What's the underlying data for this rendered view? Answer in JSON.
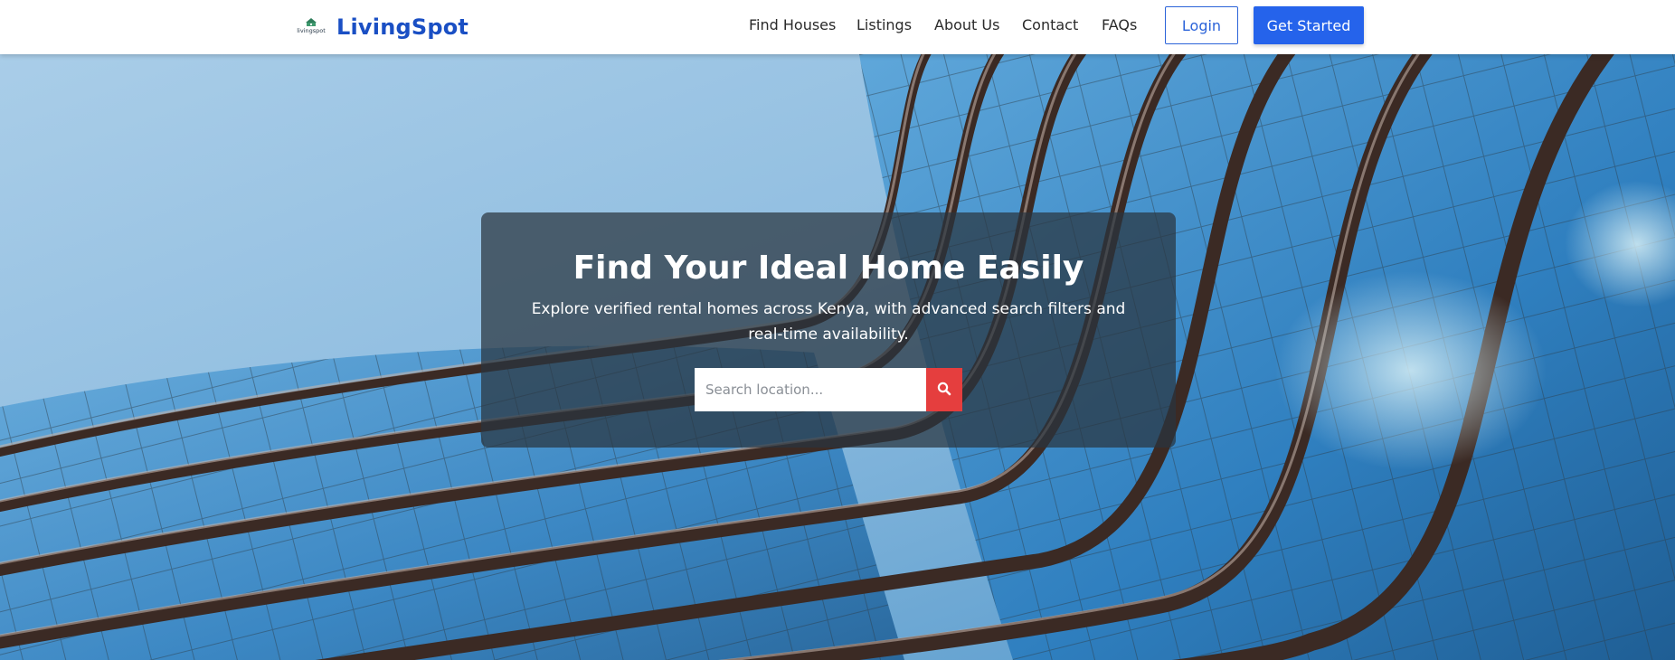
{
  "brand": {
    "name": "LivingSpot",
    "logo_text": "livingspot",
    "color": "#1a4fc4"
  },
  "nav": {
    "items": [
      {
        "label": "Find Houses"
      },
      {
        "label": "Listings"
      },
      {
        "label": "About Us"
      },
      {
        "label": "Contact"
      },
      {
        "label": "FAQs"
      }
    ],
    "login_label": "Login",
    "start_label": "Get Started"
  },
  "hero": {
    "title": "Find Your Ideal Home Easily",
    "subtitle": "Explore verified rental homes across Kenya, with advanced search filters and real-time availability.",
    "search": {
      "placeholder": "Search location...",
      "value": "",
      "button_icon": "search-icon"
    }
  },
  "colors": {
    "primary": "#2563eb",
    "search_button": "#e53e3e",
    "overlay": "#2a343e"
  }
}
